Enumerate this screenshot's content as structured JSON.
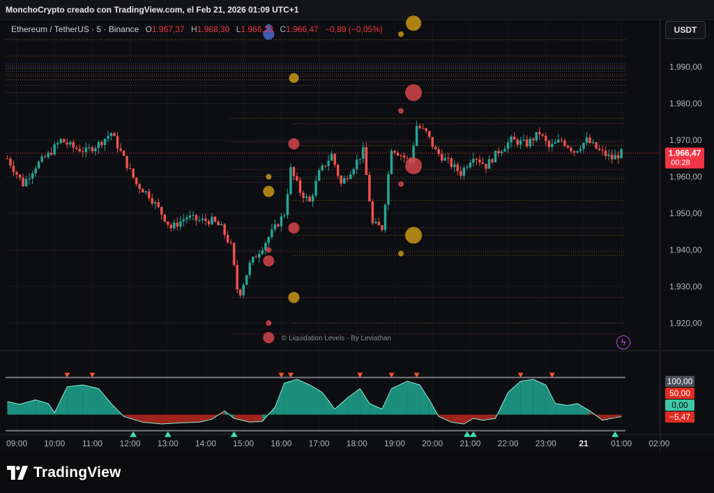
{
  "header": {
    "text": "MonchoCrypto creado con TradingView.com, el Feb 21, 2026 01:09 UTC+1"
  },
  "legend": {
    "symbol": "Ethereum / TetherUS · 5 · Binance",
    "o_label": "O",
    "o_value": "1.967,37",
    "h_label": "H",
    "h_value": "1.968,30",
    "l_label": "L",
    "l_value": "1.966,23",
    "c_label": "C",
    "c_value": "1.966,47",
    "change": "−0,89 (−0,05%)"
  },
  "currency_button": "USDT",
  "watermark": "© Liquidation Levels - By Leviathan",
  "brand": "TradingView",
  "colors": {
    "up": "#26a69a",
    "down": "#ef5350",
    "accent": "#f23645",
    "gold": "#d4a017",
    "blue": "#4a6fd8"
  },
  "chart_data": {
    "type": "candlestick",
    "y_axis_ticks": [
      "1.990,00",
      "1.980,00",
      "1.970,00",
      "1.960,00",
      "1.950,00",
      "1.940,00",
      "1.930,00",
      "1.920,00"
    ],
    "y_tick_values": [
      1990,
      1980,
      1970,
      1960,
      1950,
      1940,
      1930,
      1920
    ],
    "ylim": [
      1913,
      2003
    ],
    "x_axis_ticks": [
      "09:00",
      "10:00",
      "11:00",
      "12:00",
      "13:00",
      "14:00",
      "15:00",
      "16:00",
      "17:00",
      "18:00",
      "19:00",
      "20:00",
      "21:00",
      "22:00",
      "23:00",
      "21",
      "01:00",
      "02:00"
    ],
    "last_price": "1.966,47",
    "countdown": "00:28",
    "close_path": [
      [
        "08:45",
        1965
      ],
      [
        "09:10",
        1958
      ],
      [
        "09:30",
        1963
      ],
      [
        "09:50",
        1966
      ],
      [
        "10:10",
        1970
      ],
      [
        "10:30",
        1968
      ],
      [
        "10:50",
        1967
      ],
      [
        "11:10",
        1969
      ],
      [
        "11:30",
        1972
      ],
      [
        "11:50",
        1965
      ],
      [
        "12:10",
        1958
      ],
      [
        "12:30",
        1955
      ],
      [
        "12:50",
        1950
      ],
      [
        "13:05",
        1946
      ],
      [
        "13:30",
        1949
      ],
      [
        "13:50",
        1948
      ],
      [
        "14:10",
        1948
      ],
      [
        "14:25",
        1946
      ],
      [
        "14:40",
        1941
      ],
      [
        "14:52",
        1927
      ],
      [
        "15:10",
        1936
      ],
      [
        "15:30",
        1941
      ],
      [
        "15:50",
        1946
      ],
      [
        "16:05",
        1950
      ],
      [
        "16:15",
        1962
      ],
      [
        "16:30",
        1956
      ],
      [
        "16:45",
        1953
      ],
      [
        "17:00",
        1961
      ],
      [
        "17:20",
        1966
      ],
      [
        "17:35",
        1958
      ],
      [
        "17:55",
        1963
      ],
      [
        "18:10",
        1967
      ],
      [
        "18:25",
        1947
      ],
      [
        "18:40",
        1946
      ],
      [
        "18:55",
        1968
      ],
      [
        "19:10",
        1966
      ],
      [
        "19:25",
        1964
      ],
      [
        "19:35",
        1974
      ],
      [
        "19:50",
        1972
      ],
      [
        "20:05",
        1967
      ],
      [
        "20:25",
        1964
      ],
      [
        "20:45",
        1961
      ],
      [
        "21:05",
        1966
      ],
      [
        "21:25",
        1963
      ],
      [
        "21:45",
        1967
      ],
      [
        "22:05",
        1970
      ],
      [
        "22:30",
        1969
      ],
      [
        "22:50",
        1972
      ],
      [
        "23:05",
        1968
      ],
      [
        "23:25",
        1970
      ],
      [
        "23:45",
        1967
      ],
      [
        "00:05",
        1970
      ],
      [
        "00:25",
        1967
      ],
      [
        "00:45",
        1965
      ],
      [
        "01:00",
        1966.47
      ]
    ],
    "liquidation_levels": [
      1997.5,
      1993,
      1990.5,
      1989.5,
      1988,
      1987.5,
      1986.5,
      1985,
      1983,
      1976,
      1974.5,
      1969.5,
      1968.5,
      1962,
      1959.5,
      1958.5,
      1953.5,
      1946,
      1944,
      1939.5,
      1938.5,
      1927,
      1920,
      1917
    ],
    "bubbles": [
      {
        "x": "19:30",
        "y": 2002,
        "r": 11,
        "color": "gold"
      },
      {
        "x": "15:40",
        "y": 1999,
        "r": 8,
        "color": "blue"
      },
      {
        "x": "15:40",
        "y": 2001,
        "r": 4,
        "color": "blue"
      },
      {
        "x": "19:10",
        "y": 1999,
        "r": 4,
        "color": "gold"
      },
      {
        "x": "16:20",
        "y": 1987,
        "r": 7,
        "color": "gold"
      },
      {
        "x": "19:30",
        "y": 1983,
        "r": 12,
        "color": "red"
      },
      {
        "x": "19:10",
        "y": 1978,
        "r": 4,
        "color": "red"
      },
      {
        "x": "16:20",
        "y": 1969,
        "r": 8,
        "color": "red"
      },
      {
        "x": "19:30",
        "y": 1963,
        "r": 12,
        "color": "red"
      },
      {
        "x": "15:40",
        "y": 1960,
        "r": 4,
        "color": "gold"
      },
      {
        "x": "15:40",
        "y": 1956,
        "r": 8,
        "color": "gold"
      },
      {
        "x": "19:10",
        "y": 1958,
        "r": 4,
        "color": "red"
      },
      {
        "x": "16:20",
        "y": 1946,
        "r": 8,
        "color": "red"
      },
      {
        "x": "19:30",
        "y": 1944,
        "r": 12,
        "color": "gold"
      },
      {
        "x": "15:40",
        "y": 1940,
        "r": 4,
        "color": "red"
      },
      {
        "x": "19:10",
        "y": 1939,
        "r": 4,
        "color": "gold"
      },
      {
        "x": "15:40",
        "y": 1937,
        "r": 8,
        "color": "red"
      },
      {
        "x": "16:20",
        "y": 1927,
        "r": 8,
        "color": "gold"
      },
      {
        "x": "15:40",
        "y": 1920,
        "r": 4,
        "color": "red"
      },
      {
        "x": "15:40",
        "y": 1916,
        "r": 8,
        "color": "red"
      }
    ],
    "oscillator": {
      "labels": [
        "100,00",
        "50,00",
        "0,00",
        "−5,47"
      ],
      "levels": [
        100,
        50,
        0,
        -5.47
      ],
      "ylim": [
        -10,
        125
      ],
      "path": [
        [
          "08:45",
          35
        ],
        [
          "09:05",
          28
        ],
        [
          "09:30",
          40
        ],
        [
          "09:50",
          30
        ],
        [
          "10:00",
          5
        ],
        [
          "10:20",
          75
        ],
        [
          "10:45",
          80
        ],
        [
          "11:10",
          70
        ],
        [
          "11:30",
          30
        ],
        [
          "11:50",
          -5
        ],
        [
          "12:20",
          -20
        ],
        [
          "12:50",
          -25
        ],
        [
          "13:20",
          -22
        ],
        [
          "13:50",
          -20
        ],
        [
          "14:10",
          -12
        ],
        [
          "14:30",
          10
        ],
        [
          "14:45",
          -10
        ],
        [
          "15:10",
          -20
        ],
        [
          "15:30",
          -18
        ],
        [
          "15:50",
          20
        ],
        [
          "16:05",
          85
        ],
        [
          "16:25",
          95
        ],
        [
          "16:45",
          80
        ],
        [
          "17:05",
          60
        ],
        [
          "17:25",
          15
        ],
        [
          "17:45",
          45
        ],
        [
          "18:05",
          70
        ],
        [
          "18:20",
          30
        ],
        [
          "18:40",
          15
        ],
        [
          "18:55",
          70
        ],
        [
          "19:20",
          90
        ],
        [
          "19:40",
          80
        ],
        [
          "19:55",
          40
        ],
        [
          "20:10",
          -5
        ],
        [
          "20:30",
          -20
        ],
        [
          "20:50",
          -25
        ],
        [
          "21:05",
          -10
        ],
        [
          "21:20",
          -15
        ],
        [
          "21:40",
          -10
        ],
        [
          "22:00",
          60
        ],
        [
          "22:20",
          90
        ],
        [
          "22:40",
          95
        ],
        [
          "23:00",
          80
        ],
        [
          "23:15",
          30
        ],
        [
          "23:35",
          25
        ],
        [
          "23:50",
          30
        ],
        [
          "00:10",
          10
        ],
        [
          "00:30",
          -15
        ],
        [
          "00:50",
          -8
        ],
        [
          "01:00",
          -5.47
        ]
      ],
      "down_signals": [
        "10:20",
        "11:00",
        "16:00",
        "16:15",
        "18:05",
        "18:55",
        "19:35",
        "22:20",
        "23:10"
      ],
      "up_signals": [
        "12:05",
        "13:00",
        "14:45",
        "20:55",
        "21:05",
        "00:50"
      ]
    }
  }
}
